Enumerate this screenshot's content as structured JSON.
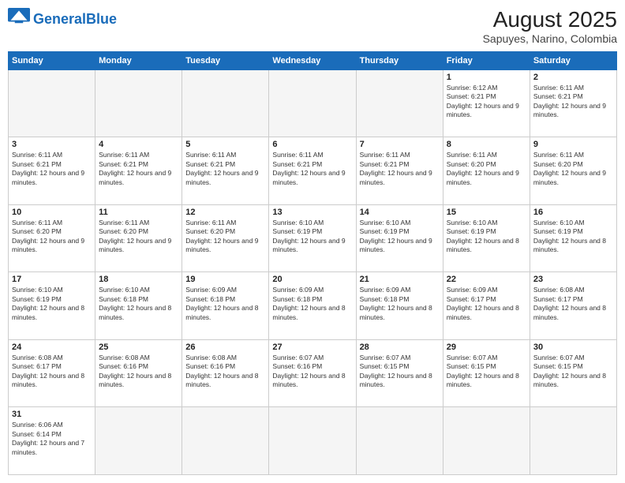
{
  "header": {
    "logo_general": "General",
    "logo_blue": "Blue",
    "title": "August 2025",
    "subtitle": "Sapuyes, Narino, Colombia"
  },
  "weekdays": [
    "Sunday",
    "Monday",
    "Tuesday",
    "Wednesday",
    "Thursday",
    "Friday",
    "Saturday"
  ],
  "weeks": [
    [
      {
        "day": "",
        "info": ""
      },
      {
        "day": "",
        "info": ""
      },
      {
        "day": "",
        "info": ""
      },
      {
        "day": "",
        "info": ""
      },
      {
        "day": "",
        "info": ""
      },
      {
        "day": "1",
        "info": "Sunrise: 6:12 AM\nSunset: 6:21 PM\nDaylight: 12 hours and 9 minutes."
      },
      {
        "day": "2",
        "info": "Sunrise: 6:11 AM\nSunset: 6:21 PM\nDaylight: 12 hours and 9 minutes."
      }
    ],
    [
      {
        "day": "3",
        "info": "Sunrise: 6:11 AM\nSunset: 6:21 PM\nDaylight: 12 hours and 9 minutes."
      },
      {
        "day": "4",
        "info": "Sunrise: 6:11 AM\nSunset: 6:21 PM\nDaylight: 12 hours and 9 minutes."
      },
      {
        "day": "5",
        "info": "Sunrise: 6:11 AM\nSunset: 6:21 PM\nDaylight: 12 hours and 9 minutes."
      },
      {
        "day": "6",
        "info": "Sunrise: 6:11 AM\nSunset: 6:21 PM\nDaylight: 12 hours and 9 minutes."
      },
      {
        "day": "7",
        "info": "Sunrise: 6:11 AM\nSunset: 6:21 PM\nDaylight: 12 hours and 9 minutes."
      },
      {
        "day": "8",
        "info": "Sunrise: 6:11 AM\nSunset: 6:20 PM\nDaylight: 12 hours and 9 minutes."
      },
      {
        "day": "9",
        "info": "Sunrise: 6:11 AM\nSunset: 6:20 PM\nDaylight: 12 hours and 9 minutes."
      }
    ],
    [
      {
        "day": "10",
        "info": "Sunrise: 6:11 AM\nSunset: 6:20 PM\nDaylight: 12 hours and 9 minutes."
      },
      {
        "day": "11",
        "info": "Sunrise: 6:11 AM\nSunset: 6:20 PM\nDaylight: 12 hours and 9 minutes."
      },
      {
        "day": "12",
        "info": "Sunrise: 6:11 AM\nSunset: 6:20 PM\nDaylight: 12 hours and 9 minutes."
      },
      {
        "day": "13",
        "info": "Sunrise: 6:10 AM\nSunset: 6:19 PM\nDaylight: 12 hours and 9 minutes."
      },
      {
        "day": "14",
        "info": "Sunrise: 6:10 AM\nSunset: 6:19 PM\nDaylight: 12 hours and 9 minutes."
      },
      {
        "day": "15",
        "info": "Sunrise: 6:10 AM\nSunset: 6:19 PM\nDaylight: 12 hours and 8 minutes."
      },
      {
        "day": "16",
        "info": "Sunrise: 6:10 AM\nSunset: 6:19 PM\nDaylight: 12 hours and 8 minutes."
      }
    ],
    [
      {
        "day": "17",
        "info": "Sunrise: 6:10 AM\nSunset: 6:19 PM\nDaylight: 12 hours and 8 minutes."
      },
      {
        "day": "18",
        "info": "Sunrise: 6:10 AM\nSunset: 6:18 PM\nDaylight: 12 hours and 8 minutes."
      },
      {
        "day": "19",
        "info": "Sunrise: 6:09 AM\nSunset: 6:18 PM\nDaylight: 12 hours and 8 minutes."
      },
      {
        "day": "20",
        "info": "Sunrise: 6:09 AM\nSunset: 6:18 PM\nDaylight: 12 hours and 8 minutes."
      },
      {
        "day": "21",
        "info": "Sunrise: 6:09 AM\nSunset: 6:18 PM\nDaylight: 12 hours and 8 minutes."
      },
      {
        "day": "22",
        "info": "Sunrise: 6:09 AM\nSunset: 6:17 PM\nDaylight: 12 hours and 8 minutes."
      },
      {
        "day": "23",
        "info": "Sunrise: 6:08 AM\nSunset: 6:17 PM\nDaylight: 12 hours and 8 minutes."
      }
    ],
    [
      {
        "day": "24",
        "info": "Sunrise: 6:08 AM\nSunset: 6:17 PM\nDaylight: 12 hours and 8 minutes."
      },
      {
        "day": "25",
        "info": "Sunrise: 6:08 AM\nSunset: 6:16 PM\nDaylight: 12 hours and 8 minutes."
      },
      {
        "day": "26",
        "info": "Sunrise: 6:08 AM\nSunset: 6:16 PM\nDaylight: 12 hours and 8 minutes."
      },
      {
        "day": "27",
        "info": "Sunrise: 6:07 AM\nSunset: 6:16 PM\nDaylight: 12 hours and 8 minutes."
      },
      {
        "day": "28",
        "info": "Sunrise: 6:07 AM\nSunset: 6:15 PM\nDaylight: 12 hours and 8 minutes."
      },
      {
        "day": "29",
        "info": "Sunrise: 6:07 AM\nSunset: 6:15 PM\nDaylight: 12 hours and 8 minutes."
      },
      {
        "day": "30",
        "info": "Sunrise: 6:07 AM\nSunset: 6:15 PM\nDaylight: 12 hours and 8 minutes."
      }
    ],
    [
      {
        "day": "31",
        "info": "Sunrise: 6:06 AM\nSunset: 6:14 PM\nDaylight: 12 hours and 7 minutes."
      },
      {
        "day": "",
        "info": ""
      },
      {
        "day": "",
        "info": ""
      },
      {
        "day": "",
        "info": ""
      },
      {
        "day": "",
        "info": ""
      },
      {
        "day": "",
        "info": ""
      },
      {
        "day": "",
        "info": ""
      }
    ]
  ]
}
